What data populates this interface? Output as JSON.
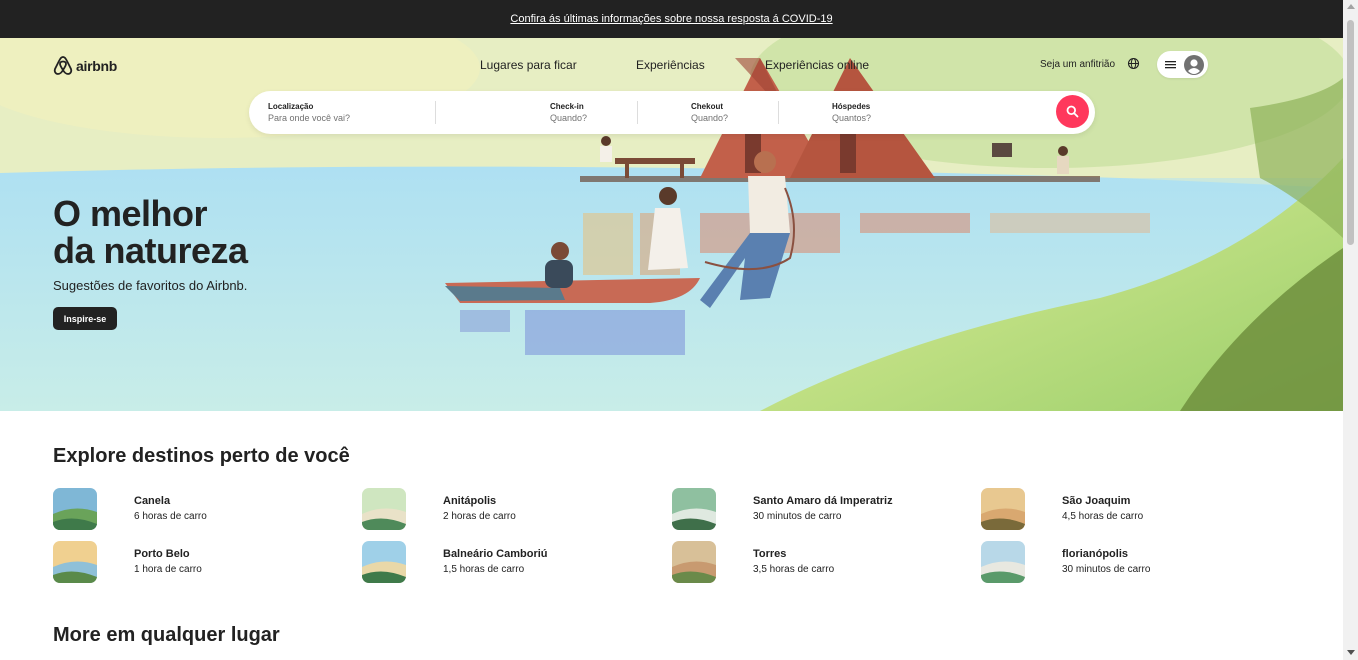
{
  "banner": {
    "text": "Confira ás últimas informações sobre nossa resposta á COVID-19"
  },
  "header": {
    "logo": "airbnb",
    "nav": [
      "Lugares para ficar",
      "Experiências",
      "Experiências online"
    ],
    "host_link": "Seja um anfitrião",
    "icons": {
      "globe": "globe-icon",
      "menu": "menu-icon",
      "user": "user-avatar-icon"
    }
  },
  "search": {
    "location": {
      "label": "Localização",
      "placeholder": "Para onde você vai?"
    },
    "checkin": {
      "label": "Check-in",
      "placeholder": "Quando?"
    },
    "checkout": {
      "label": "Chekout",
      "placeholder": "Quando?"
    },
    "guests": {
      "label": "Hóspedes",
      "placeholder": "Quantos?"
    },
    "button_icon": "search-icon"
  },
  "hero": {
    "title_line1": "O melhor",
    "title_line2": "da natureza",
    "subtitle": "Sugestões de favoritos do Airbnb.",
    "cta": "Inspire-se"
  },
  "explore": {
    "title": "Explore destinos perto de você",
    "destinations": [
      {
        "name": "Canela",
        "distance": "6 horas de carro"
      },
      {
        "name": "Anitápolis",
        "distance": "2 horas de carro"
      },
      {
        "name": "Santo Amaro dá Imperatriz",
        "distance": "30 minutos de carro"
      },
      {
        "name": "São Joaquim",
        "distance": "4,5 horas de carro"
      },
      {
        "name": "Porto Belo",
        "distance": "1 hora de carro"
      },
      {
        "name": "Balneário Camboriú",
        "distance": "1,5 horas de carro"
      },
      {
        "name": "Torres",
        "distance": "3,5 horas de carro"
      },
      {
        "name": "florianópolis",
        "distance": "30 minutos de carro"
      }
    ]
  },
  "more": {
    "title": "More em qualquer lugar"
  },
  "colors": {
    "brand": "#ff385c",
    "dark": "#222222",
    "banner_bg": "#222222"
  }
}
